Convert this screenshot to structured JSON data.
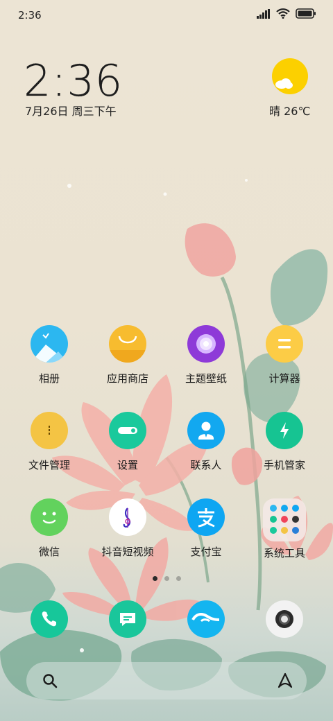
{
  "status_bar": {
    "time": "2:36"
  },
  "clock_widget": {
    "time": "2:36",
    "date": "7月26日 周三下午"
  },
  "weather_widget": {
    "text": "晴 26℃",
    "icon": "sun-cloud-icon"
  },
  "apps": [
    {
      "label": "相册",
      "icon": "gallery-icon",
      "color": "#2cb7f0"
    },
    {
      "label": "应用商店",
      "icon": "app-store-icon",
      "color": "#f7bc2f"
    },
    {
      "label": "主题壁纸",
      "icon": "theme-icon",
      "color": "#8e3ad8"
    },
    {
      "label": "计算器",
      "icon": "calculator-icon",
      "color": "#fccc46"
    },
    {
      "label": "文件管理",
      "icon": "file-manager-icon",
      "color": "#f4c444"
    },
    {
      "label": "设置",
      "icon": "settings-icon",
      "color": "#1ac99c"
    },
    {
      "label": "联系人",
      "icon": "contacts-icon",
      "color": "#12a8f0"
    },
    {
      "label": "手机管家",
      "icon": "security-icon",
      "color": "#16c492"
    },
    {
      "label": "微信",
      "icon": "wechat-icon",
      "color": "#62d25d"
    },
    {
      "label": "抖音短视频",
      "icon": "douyin-icon",
      "color": "#ffffff"
    },
    {
      "label": "支付宝",
      "icon": "alipay-icon",
      "color": "#0ea6f2"
    },
    {
      "label": "系统工具",
      "icon": "folder-icon",
      "color": "#f3e9e5"
    }
  ],
  "page_indicator": {
    "count": 3,
    "active": 0
  },
  "dock": [
    {
      "name": "phone",
      "icon": "phone-icon",
      "color": "#17c79a"
    },
    {
      "name": "messages",
      "icon": "message-icon",
      "color": "#1ac69b"
    },
    {
      "name": "browser",
      "icon": "browser-icon",
      "color": "#14b5f0"
    },
    {
      "name": "camera",
      "icon": "camera-icon",
      "color": "#f2f2f2"
    }
  ],
  "search_bar": {
    "left_icon": "search-icon",
    "right_icon": "assistant-icon"
  }
}
